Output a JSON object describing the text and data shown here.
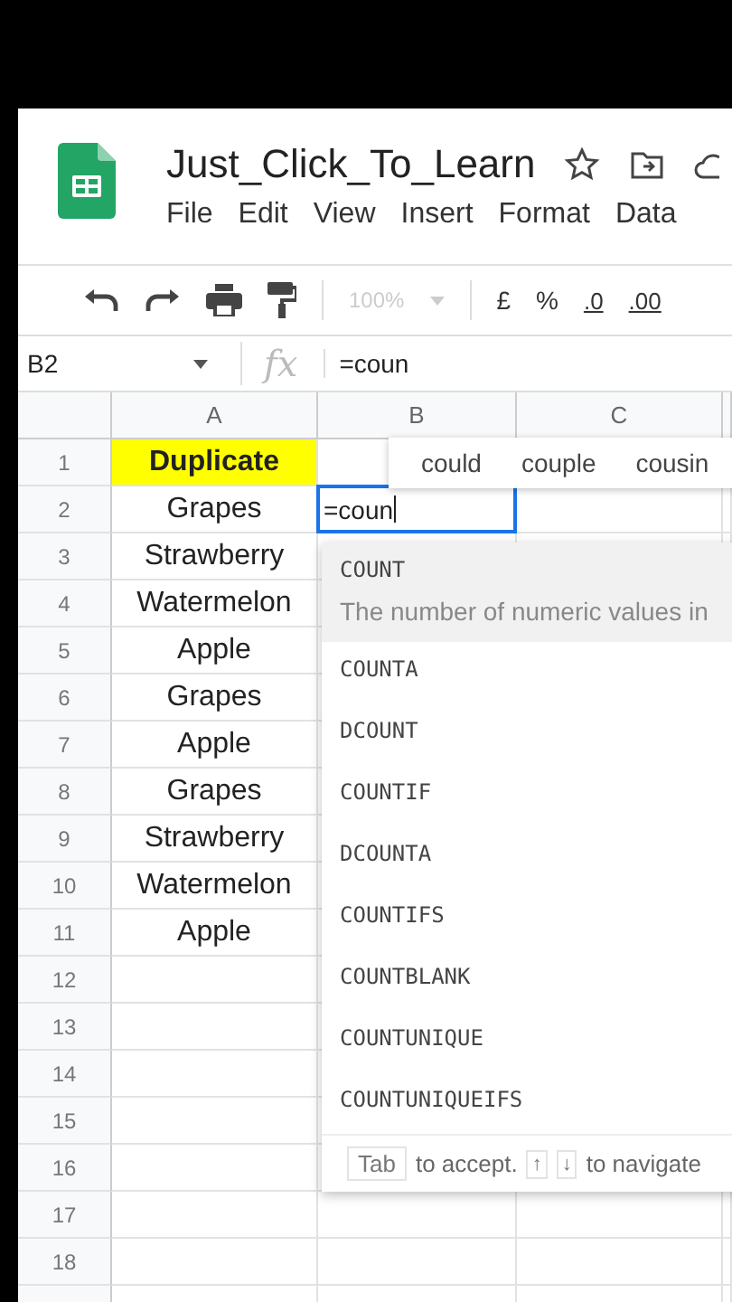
{
  "document": {
    "title": "Just_Click_To_Learn"
  },
  "menu": [
    "File",
    "Edit",
    "View",
    "Insert",
    "Format",
    "Data"
  ],
  "toolbar": {
    "zoom": "100%",
    "currency": "£",
    "percent": "%",
    "decrease_decimals": ".0",
    "increase_decimals": ".00"
  },
  "formula_bar": {
    "cell_ref": "B2",
    "fx": "fx",
    "formula": "=coun"
  },
  "columns": [
    "A",
    "B",
    "C"
  ],
  "rows": [
    {
      "number": "1",
      "a": "Duplicate",
      "kind": "header",
      "editing": false
    },
    {
      "number": "2",
      "a": "Grapes",
      "b": "=coun",
      "kind": "data",
      "editing": true
    },
    {
      "number": "3",
      "a": "Strawberry",
      "kind": "data",
      "editing": false
    },
    {
      "number": "4",
      "a": "Watermelon",
      "kind": "data",
      "editing": false
    },
    {
      "number": "5",
      "a": "Apple",
      "kind": "data",
      "editing": false
    },
    {
      "number": "6",
      "a": "Grapes",
      "kind": "data",
      "editing": false
    },
    {
      "number": "7",
      "a": "Apple",
      "kind": "data",
      "editing": false
    },
    {
      "number": "8",
      "a": "Grapes",
      "kind": "data",
      "editing": false
    },
    {
      "number": "9",
      "a": "Strawberry",
      "kind": "data",
      "editing": false
    },
    {
      "number": "10",
      "a": "Watermelon",
      "kind": "data",
      "editing": false
    },
    {
      "number": "11",
      "a": "Apple",
      "kind": "data",
      "editing": false
    },
    {
      "number": "12",
      "kind": "data",
      "editing": false
    },
    {
      "number": "13",
      "kind": "data",
      "editing": false
    },
    {
      "number": "14",
      "kind": "data",
      "editing": false
    },
    {
      "number": "15",
      "kind": "data",
      "editing": false
    },
    {
      "number": "16",
      "kind": "data",
      "editing": false
    },
    {
      "number": "17",
      "kind": "data",
      "editing": false
    },
    {
      "number": "18",
      "kind": "data",
      "editing": false
    }
  ],
  "word_suggestions": [
    "could",
    "couple",
    "cousin"
  ],
  "function_suggestions": [
    {
      "name": "COUNT",
      "selected": true,
      "description": "The number of numeric values in"
    },
    {
      "name": "COUNTA",
      "selected": false
    },
    {
      "name": "DCOUNT",
      "selected": false
    },
    {
      "name": "COUNTIF",
      "selected": false
    },
    {
      "name": "DCOUNTA",
      "selected": false
    },
    {
      "name": "COUNTIFS",
      "selected": false
    },
    {
      "name": "COUNTBLANK",
      "selected": false
    },
    {
      "name": "COUNTUNIQUE",
      "selected": false
    },
    {
      "name": "COUNTUNIQUEIFS",
      "selected": false
    }
  ],
  "hint": {
    "key": "Tab",
    "accept": "to accept.",
    "up": "↑",
    "down": "↓",
    "navigate": "to navigate"
  }
}
